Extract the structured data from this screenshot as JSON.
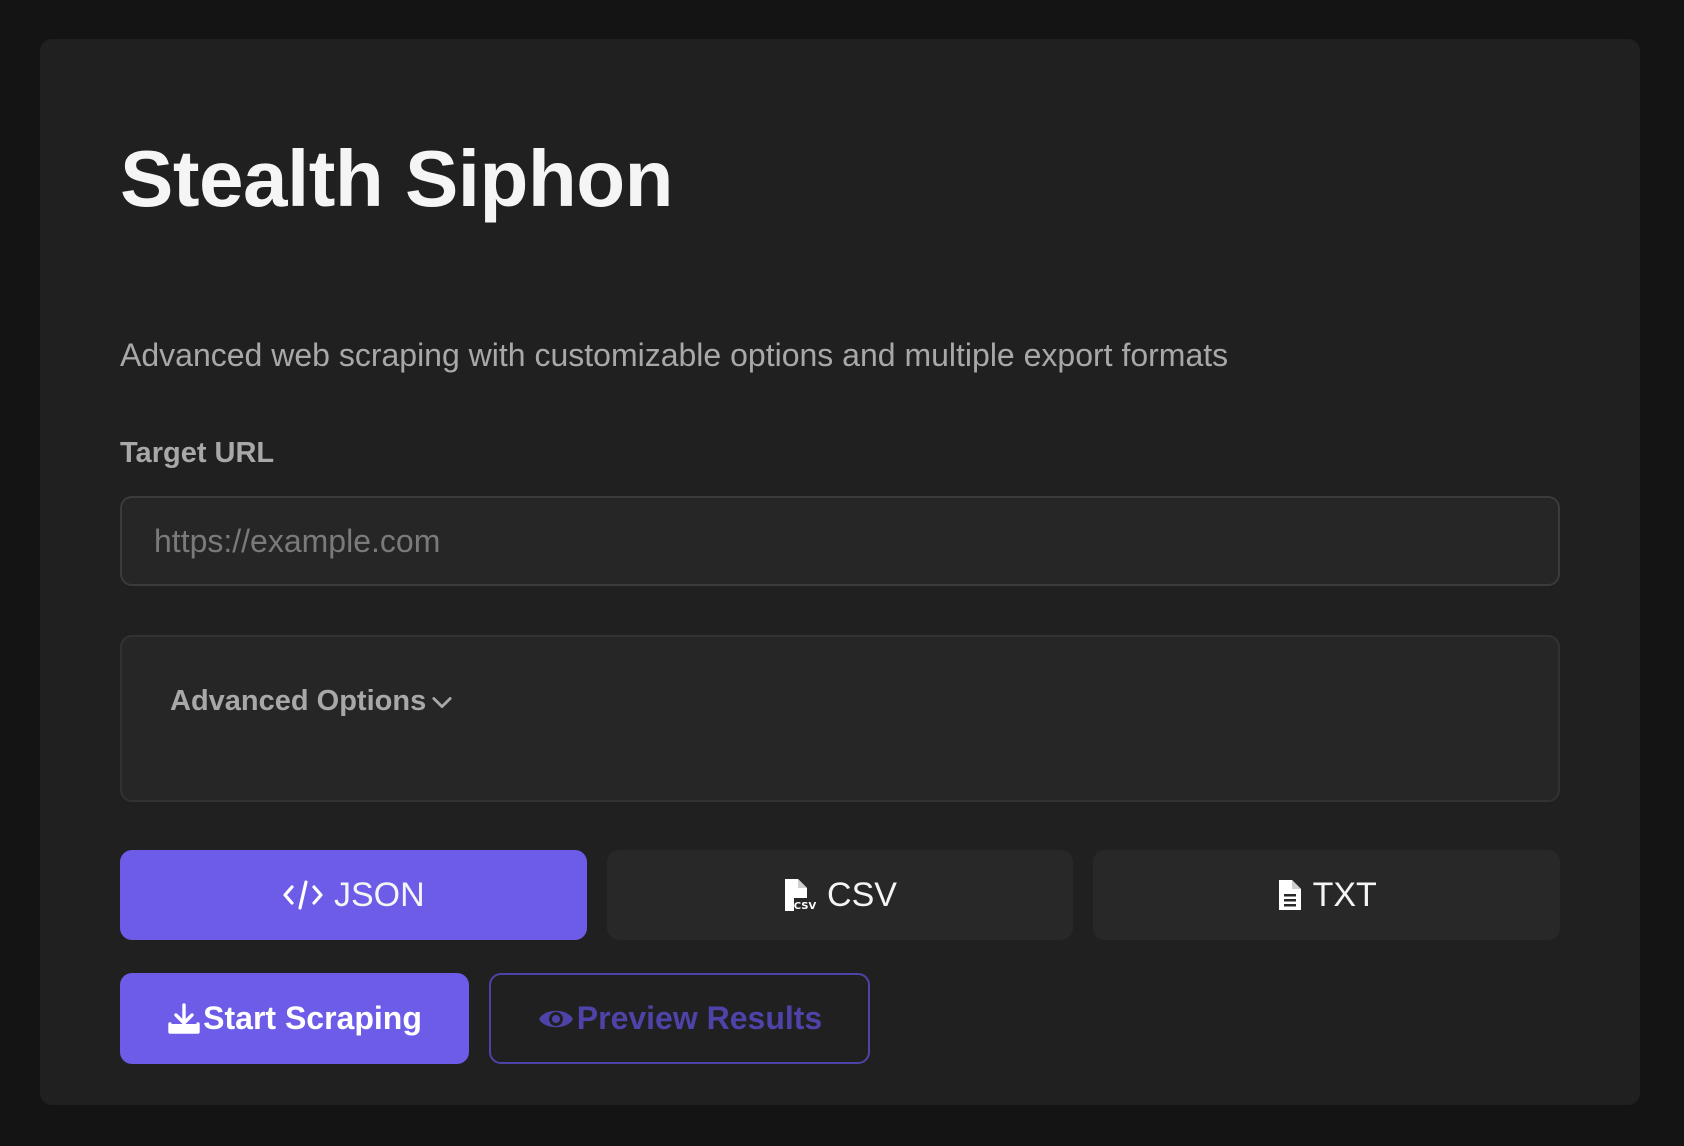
{
  "app": {
    "title": "Stealth Siphon",
    "subtitle": "Advanced web scraping with customizable options and multiple export formats"
  },
  "url_field": {
    "label": "Target URL",
    "value": "",
    "placeholder": "https://example.com"
  },
  "advanced": {
    "label": "Advanced Options",
    "icon": "chevron-down-icon",
    "expanded": false
  },
  "formats": {
    "selected": "JSON",
    "items": [
      {
        "label": "JSON",
        "icon": "code-icon"
      },
      {
        "label": "CSV",
        "icon": "file-csv-icon"
      },
      {
        "label": "TXT",
        "icon": "file-text-icon"
      }
    ]
  },
  "actions": {
    "start_label": "Start Scraping",
    "start_icon": "download-icon",
    "preview_label": "Preview Results",
    "preview_icon": "eye-icon"
  },
  "colors": {
    "page_background": "#141414",
    "card_background": "#202020",
    "accent": "#6c5ce7",
    "preview_accent": "#4e43a8",
    "muted_text": "#a8a8a8"
  }
}
